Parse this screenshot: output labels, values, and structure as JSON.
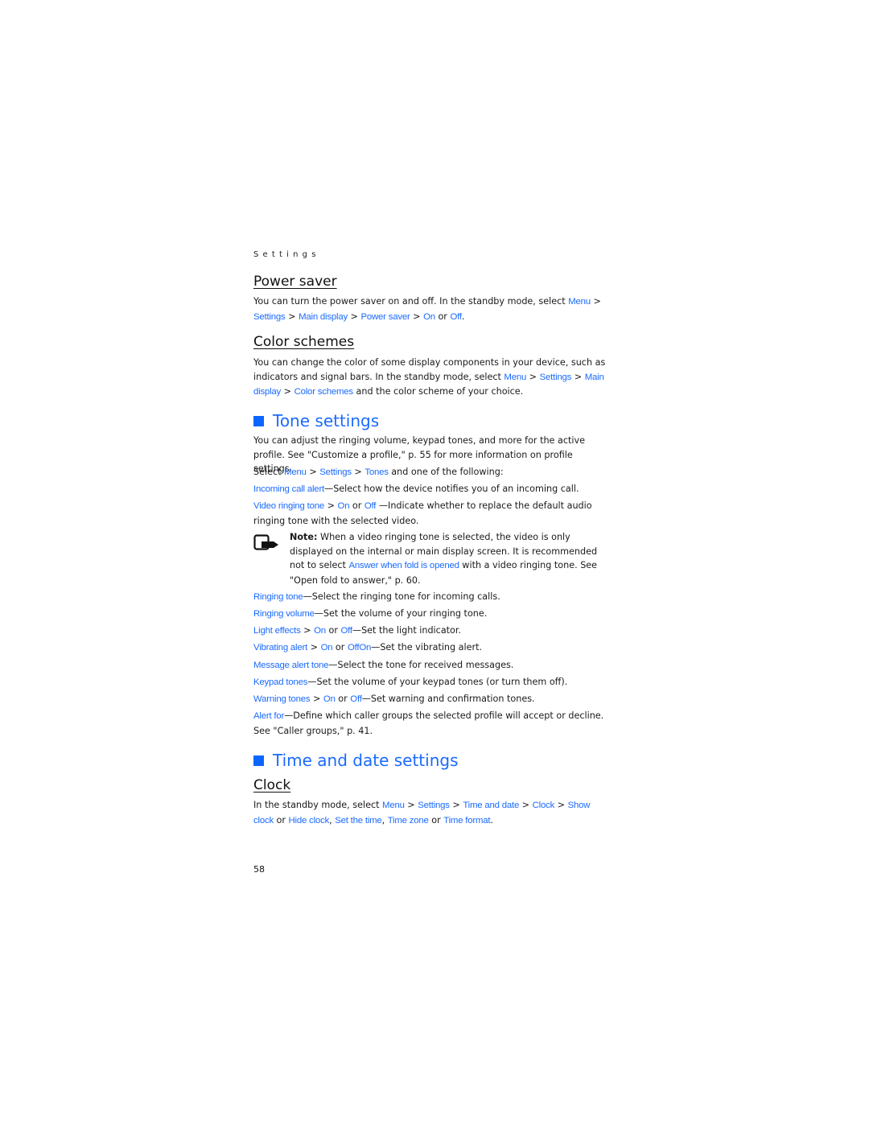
{
  "running_head": "Settings",
  "page_number": "58",
  "colors": {
    "link": "#1a6aff",
    "heading": "#1a6aff",
    "heading_square": "#0a66ff",
    "body_text": "#1a1a1a"
  },
  "power_saver": {
    "title": "Power saver",
    "body": {
      "t1": "You can turn the power saver on and off. In the standby mode, select ",
      "l1": "Menu",
      "t2": " > ",
      "l2": "Settings",
      "t3": " > ",
      "l3": "Main display",
      "t4": " > ",
      "l4": "Power saver",
      "t5": " > ",
      "l5": "On",
      "t6": " or ",
      "l6": "Off",
      "t7": "."
    }
  },
  "color_schemes": {
    "title": "Color schemes",
    "body": {
      "t1": "You can change the color of some display components in your device, such as indicators and signal bars. In the standby mode, select ",
      "l1": "Menu",
      "t2": " > ",
      "l2": "Settings",
      "t3": " > ",
      "l3": "Main display",
      "t4": " > ",
      "l4": "Color schemes",
      "t5": " and the color scheme of your choice."
    }
  },
  "tone_settings": {
    "title": "Tone settings",
    "intro": "You can adjust the ringing volume, keypad tones, and more for the active profile. See \"Customize a profile,\" p. 55 for more information on profile settings.",
    "select": {
      "t1": "Select ",
      "l1": "Menu",
      "t2": " > ",
      "l2": "Settings",
      "t3": " > ",
      "l3": "Tones",
      "t4": " and one of the following:"
    },
    "items": [
      {
        "links": [
          "Incoming call alert"
        ],
        "sep": [],
        "desc": "—Select how the device notifies you of an incoming call."
      },
      {
        "links": [
          "Video ringing tone",
          "On",
          "Off"
        ],
        "sep": [
          " > ",
          " or "
        ],
        "desc": " —Indicate whether to replace the default audio ringing tone with the selected video."
      },
      {
        "links": [
          "Ringing tone"
        ],
        "sep": [],
        "desc": "—Select the ringing tone for incoming calls."
      },
      {
        "links": [
          "Ringing volume"
        ],
        "sep": [],
        "desc": "—Set the volume of your ringing tone."
      },
      {
        "links": [
          "Light effects",
          "On",
          "Off"
        ],
        "sep": [
          " > ",
          " or "
        ],
        "desc": "—Set the light indicator."
      },
      {
        "links": [
          "Vibrating alert",
          "On",
          "OffOn"
        ],
        "sep": [
          " > ",
          " or "
        ],
        "desc": "—Set the vibrating alert."
      },
      {
        "links": [
          "Message alert tone"
        ],
        "sep": [],
        "desc": "—Select the tone for received messages."
      },
      {
        "links": [
          "Keypad tones"
        ],
        "sep": [],
        "desc": "—Set the volume of your keypad tones (or turn them off)."
      },
      {
        "links": [
          "Warning tones",
          "On",
          "Off"
        ],
        "sep": [
          " > ",
          " or "
        ],
        "desc": "—Set warning and confirmation tones."
      },
      {
        "links": [
          "Alert for"
        ],
        "sep": [],
        "desc": "—Define which caller groups the selected profile will accept or decline. See \"Caller groups,\" p. 41."
      }
    ],
    "note": {
      "icon": "note-icon",
      "label": "Note:",
      "t1": " When a video ringing tone is selected, the video is only displayed on the internal or main display screen. It is recommended not to select ",
      "l1": "Answer when fold is opened",
      "t2": " with a video ringing tone. See \"Open fold to answer,\" p. 60."
    }
  },
  "time_date": {
    "title": "Time and date settings",
    "clock": {
      "title": "Clock",
      "body": {
        "t1": "In the standby mode, select ",
        "l1": "Menu",
        "t2": " > ",
        "l2": "Settings",
        "t3": " > ",
        "l3": "Time and date",
        "t4": " > ",
        "l4": "Clock",
        "t5": " > ",
        "l5": "Show clock",
        "t6": " or ",
        "l6": "Hide clock",
        "t7": ", ",
        "l7": "Set the time",
        "t8": ", ",
        "l8": "Time zone",
        "t9": " or ",
        "l9": "Time format",
        "t10": "."
      }
    }
  }
}
